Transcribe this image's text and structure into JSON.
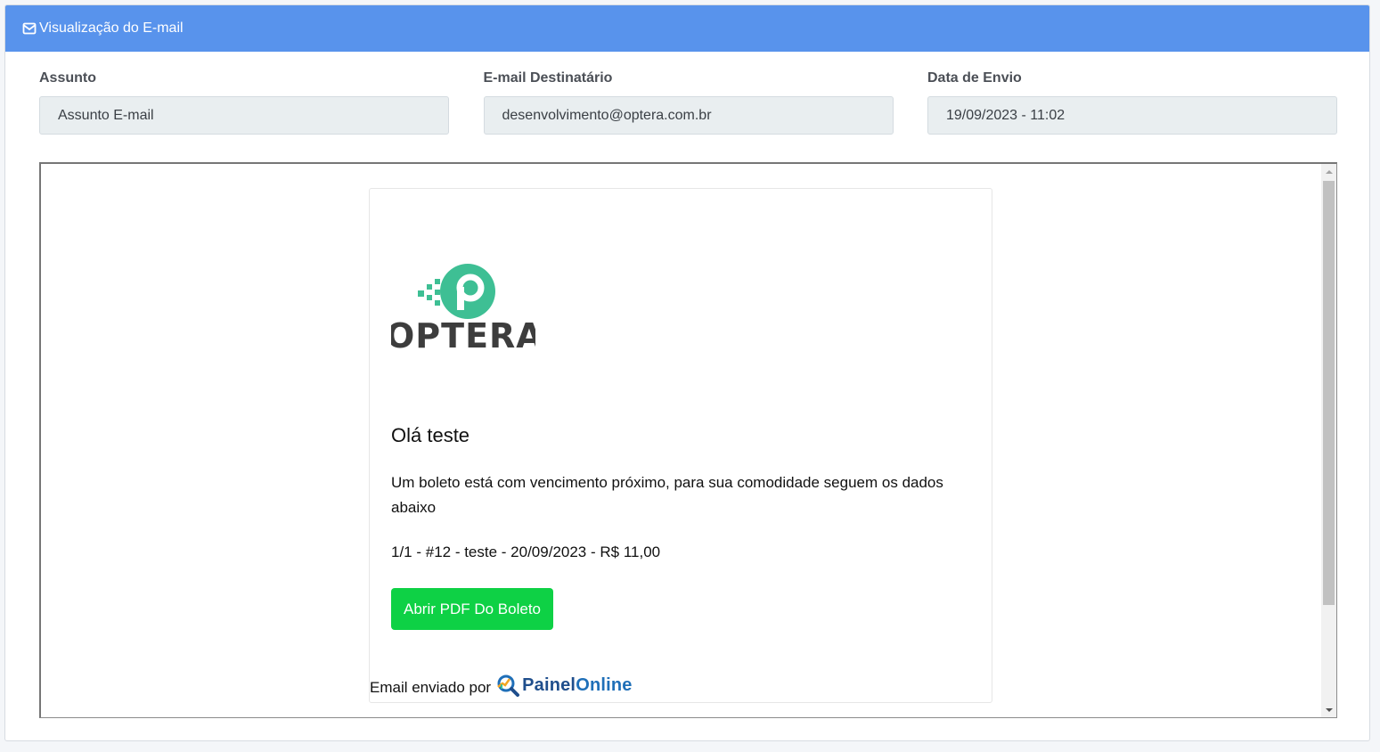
{
  "header": {
    "title": "Visualização do E-mail",
    "icon": "envelope-icon",
    "background_color": "#5893ec"
  },
  "fields": {
    "subject": {
      "label": "Assunto",
      "value": "Assunto E-mail"
    },
    "recipient": {
      "label": "E-mail Destinatário",
      "value": "desenvolvimento@optera.com.br"
    },
    "sent_date": {
      "label": "Data de Envio",
      "value": "19/09/2023 - 11:02"
    }
  },
  "email": {
    "logo_text": "OPTERA",
    "logo_color": "#3ebf94",
    "greeting": "Olá teste",
    "message": "Um boleto está com vencimento próximo, para sua comodidade seguem os dados abaixo",
    "boleto_line": "1/1 - #12 - teste - 20/09/2023 - R$ 11,00",
    "button_label": "Abrir PDF Do Boleto",
    "button_color": "#0ed145",
    "footer_text": "Email enviado por",
    "footer_brand_part1": "Painel",
    "footer_brand_part2": "Online"
  }
}
